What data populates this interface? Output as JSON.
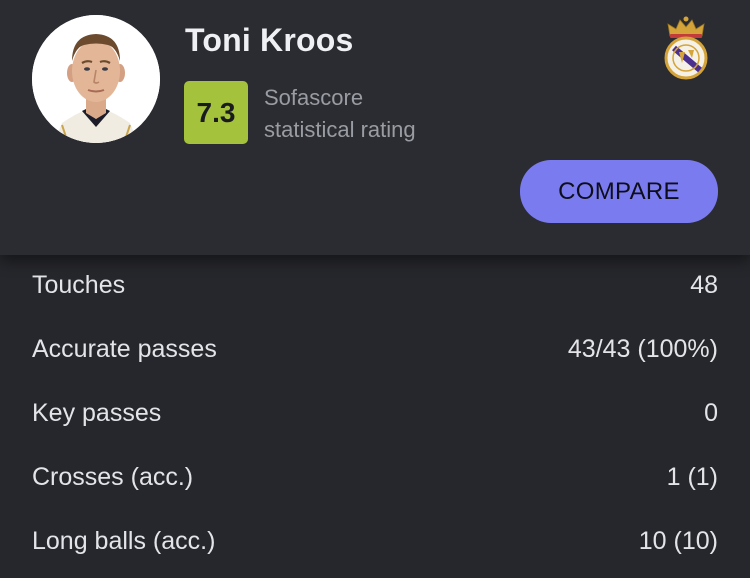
{
  "player": {
    "name": "Toni Kroos",
    "avatar_icon": "player-photo",
    "club_icon": "real-madrid-crest"
  },
  "rating": {
    "value": "7.3",
    "label_line1": "Sofascore",
    "label_line2": "statistical rating",
    "color": "#a5c23c"
  },
  "compare_button": {
    "label": "COMPARE",
    "color": "#7b7bf0"
  },
  "stats": [
    {
      "label": "Touches",
      "value": "48"
    },
    {
      "label": "Accurate passes",
      "value": "43/43 (100%)"
    },
    {
      "label": "Key passes",
      "value": "0"
    },
    {
      "label": "Crosses (acc.)",
      "value": "1 (1)"
    },
    {
      "label": "Long balls (acc.)",
      "value": "10 (10)"
    }
  ]
}
